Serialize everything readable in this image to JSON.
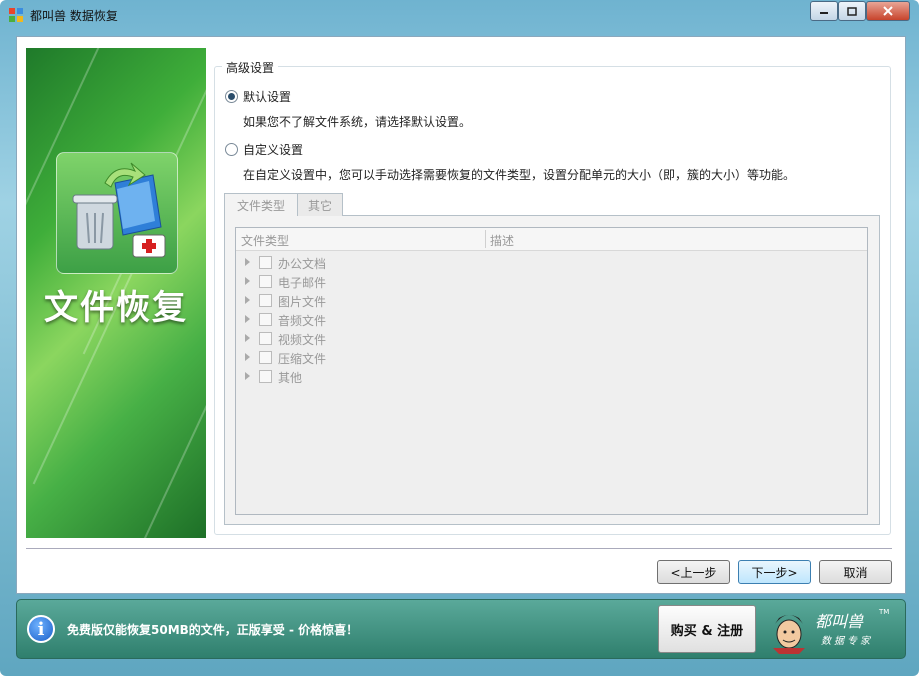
{
  "window": {
    "title": "都叫兽 数据恢复"
  },
  "banner": {
    "title": "文件恢复"
  },
  "settings": {
    "group_title": "高级设置",
    "default_label": "默认设置",
    "default_desc": "如果您不了解文件系统，请选择默认设置。",
    "custom_label": "自定义设置",
    "custom_desc": "在自定义设置中，您可以手动选择需要恢复的文件类型，设置分配单元的大小（即，簇的大小）等功能。",
    "selected": "default"
  },
  "tabs": [
    {
      "label": "文件类型",
      "active": true
    },
    {
      "label": "其它",
      "active": false
    }
  ],
  "table": {
    "columns": [
      "文件类型",
      "描述"
    ],
    "rows": [
      "办公文档",
      "电子邮件",
      "图片文件",
      "音频文件",
      "视频文件",
      "压缩文件",
      "其他"
    ]
  },
  "buttons": {
    "prev": "<上一步",
    "next": "下一步>",
    "cancel": "取消"
  },
  "footer": {
    "notice": "免费版仅能恢复50MB的文件，正版享受 - 价格惊喜！",
    "buy": "购买 & 注册",
    "logo_text": "都叫兽",
    "logo_sub": "数据专家",
    "logo_tm": "TM"
  },
  "colors": {
    "banner_green": "#3fae3a",
    "footer_teal": "#2f7f6d",
    "accent": "#3c7fb1"
  }
}
